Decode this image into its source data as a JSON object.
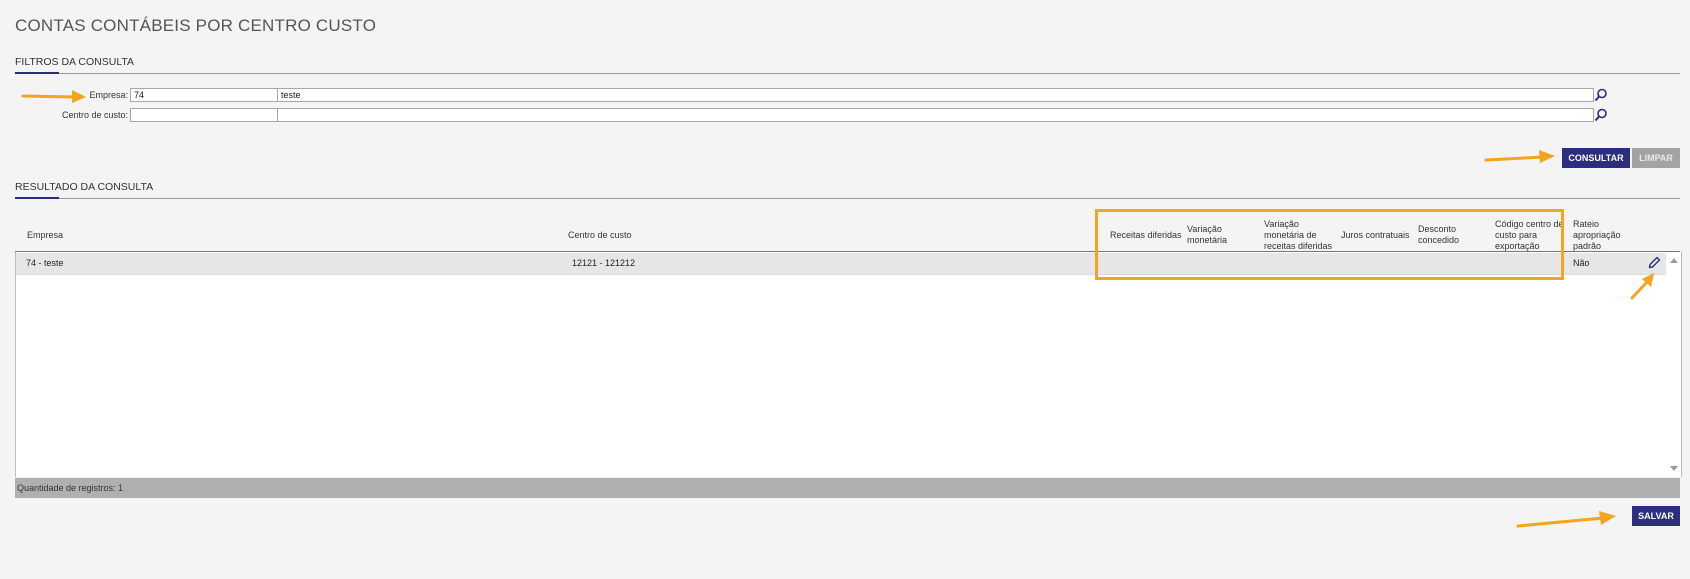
{
  "page": {
    "title": "CONTAS CONTÁBEIS POR CENTRO CUSTO"
  },
  "filters": {
    "section_title": "FILTROS DA CONSULTA",
    "empresa": {
      "label": "Empresa:",
      "code": "74",
      "description": "teste"
    },
    "centro_custo": {
      "label": "Centro de custo:",
      "code": "",
      "description": ""
    },
    "consultar_label": "CONSULTAR",
    "limpar_label": "LIMPAR"
  },
  "results": {
    "section_title": "RESULTADO DA CONSULTA",
    "columns": {
      "empresa": "Empresa",
      "centro_custo": "Centro de custo",
      "receitas_diferidas": "Receitas diferidas",
      "variacao_monetaria": "Variação monetária",
      "variacao_monetaria_receitas": "Variação monetária de receitas diferidas",
      "juros_contratuais": "Juros contratuais",
      "desconto_concedido": "Desconto concedido",
      "codigo_centro_exportacao": "Código centro de custo para exportação",
      "rateio_apropriacao": "Rateio apropriação padrão"
    },
    "rows": [
      {
        "empresa": "74 - teste",
        "centro_custo": "12121 - 121212",
        "receitas_diferidas": "",
        "variacao_monetaria": "",
        "variacao_monetaria_receitas": "",
        "juros_contratuais": "",
        "desconto_concedido": "",
        "codigo_centro_exportacao": "",
        "rateio_apropriacao": "Não"
      }
    ],
    "footer_text": "Quantidade de registros: 1"
  },
  "actions": {
    "salvar_label": "SALVAR"
  },
  "icons": {
    "lookup": "search-icon",
    "edit": "pencil-icon"
  },
  "colors": {
    "primary": "#2b2d7e",
    "disabled": "#a3a3a3",
    "annotation": "#f3a51d"
  }
}
